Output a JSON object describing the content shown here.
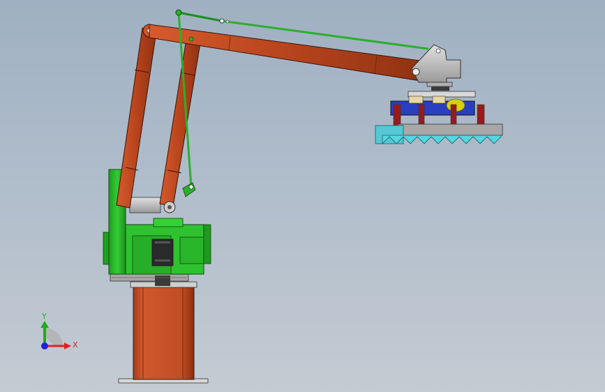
{
  "viewport": {
    "background_top": "#9fb0c2",
    "background_bottom": "#c4cbd3"
  },
  "model": {
    "parts": [
      "base-column",
      "turntable",
      "rotation-motor",
      "lower-arm",
      "upper-arm",
      "parallel-link-rod",
      "wrist-joint",
      "vacuum-gripper"
    ],
    "colors": {
      "arm": "#b7441d",
      "base_frame": "#2cc22c",
      "column": "#c5502a",
      "link_rod": "#22aa22",
      "wrist": "#b8b8b8",
      "gripper_beam": "#2a3fc0",
      "cylinder": "#d8d000",
      "suction_cups": "#55d6e0"
    }
  },
  "triad": {
    "x_label": "X",
    "y_label": "Y",
    "x_color": "#e02020",
    "y_color": "#18b018",
    "z_color": "#2020e0"
  }
}
